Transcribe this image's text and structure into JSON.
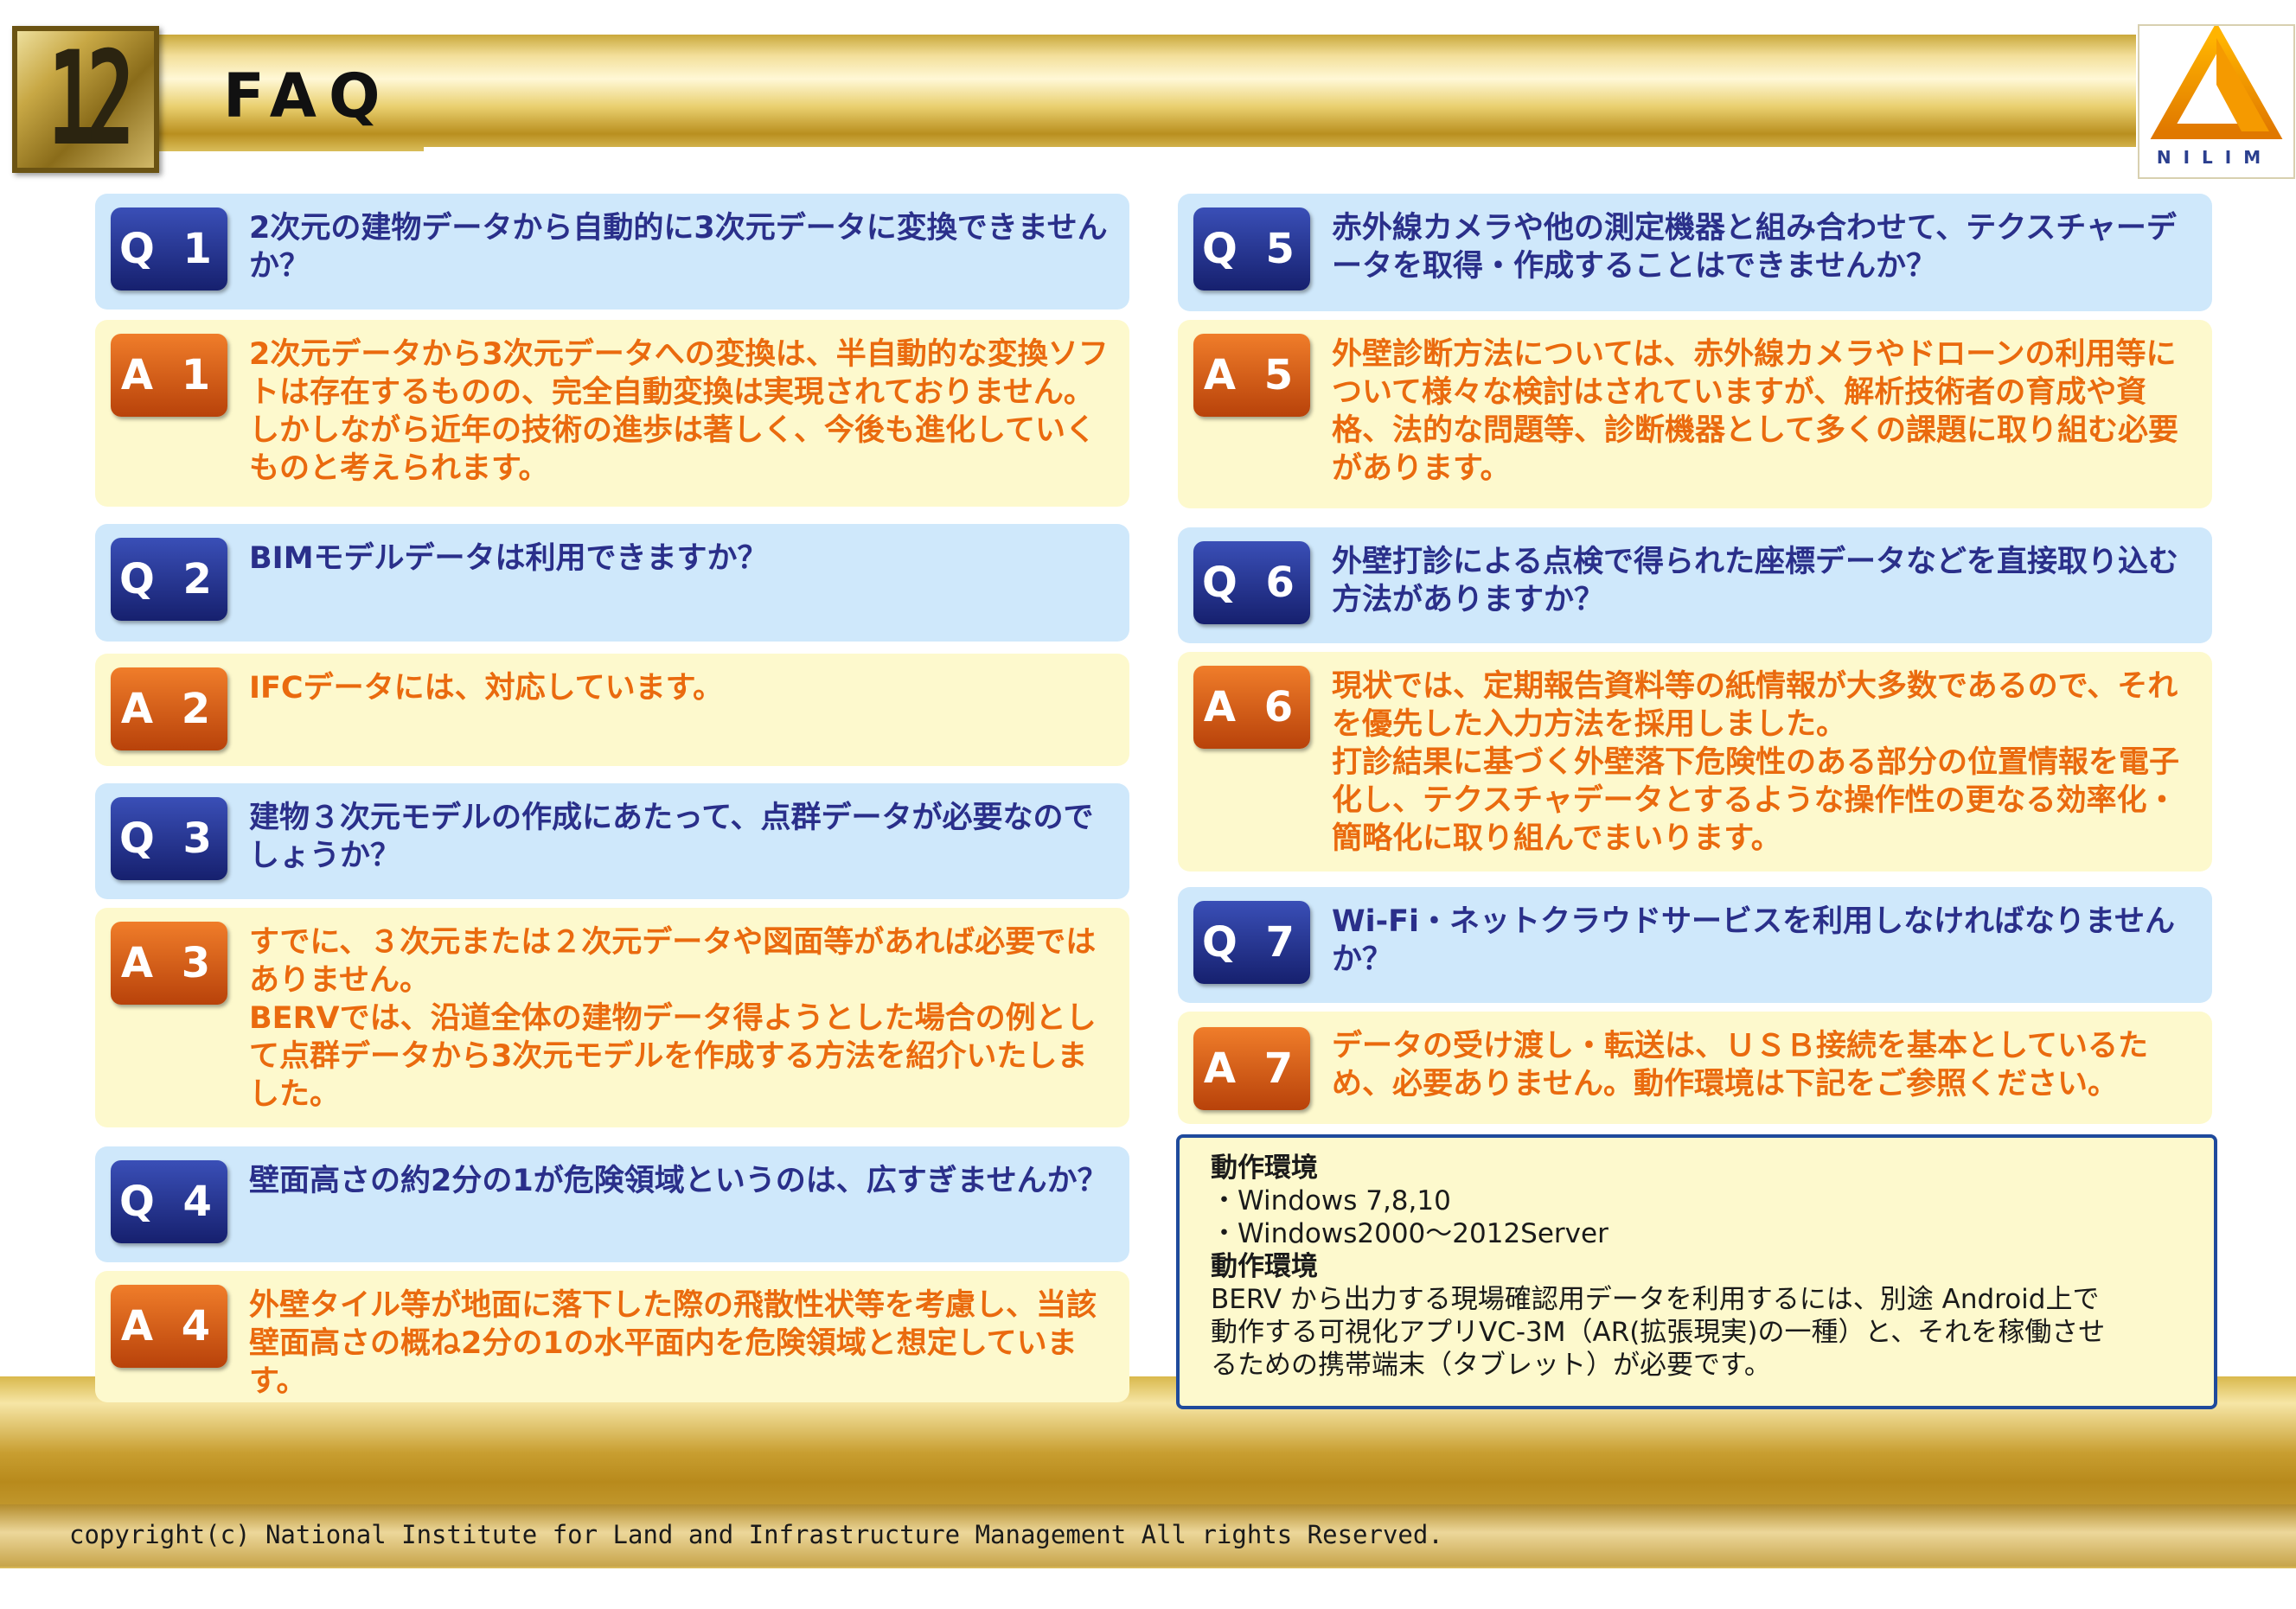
{
  "header": {
    "page_number": "12",
    "title": "FAQ",
    "logo_text": "NILIM"
  },
  "colors": {
    "question_text": "#2a2f8a",
    "answer_text": "#ea6a0e",
    "question_bg": "#cfe8fb",
    "answer_bg": "#fdf9cd",
    "gold": "#c8a03a"
  },
  "faq": [
    {
      "q_label": "Q 1",
      "q_text": "2次元の建物データから自動的に3次元データに変換できませんか？",
      "a_label": "A 1",
      "a_text": [
        "2次元データから3次元データへの変換は、半自動的な変換ソフトは存在するものの、完全自動変換は実現されておりません。しかしながら近年の技術の進歩は著しく、今後も進化していくものと考えられます。"
      ]
    },
    {
      "q_label": "Q 2",
      "q_text": "BIMモデルデータは利用できますか？",
      "a_label": "A 2",
      "a_text": [
        "IFCデータには、対応しています。"
      ]
    },
    {
      "q_label": "Q 3",
      "q_text": "建物３次元モデルの作成にあたって、点群データが必要なのでしょうか？",
      "a_label": "A 3",
      "a_text": [
        "すでに、３次元または２次元データや図面等があれば必要ではありません。",
        "BERVでは、沿道全体の建物データ得ようとした場合の例として点群データから3次元モデルを作成する方法を紹介いたしました。"
      ]
    },
    {
      "q_label": "Q 4",
      "q_text": "壁面高さの約2分の1が危険領域というのは、広すぎませんか？",
      "a_label": "A 4",
      "a_text": [
        "外壁タイル等が地面に落下した際の飛散性状等を考慮し、当該壁面高さの概ね2分の1の水平面内を危険領域と想定しています。"
      ]
    },
    {
      "q_label": "Q 5",
      "q_text": "赤外線カメラや他の測定機器と組み合わせて、テクスチャーデータを取得・作成することはできませんか？",
      "a_label": "A 5",
      "a_text": [
        "外壁診断方法については、赤外線カメラやドローンの利用等について様々な検討はされていますが、解析技術者の育成や資格、法的な問題等、診断機器として多くの課題に取り組む必要があります。"
      ]
    },
    {
      "q_label": "Q 6",
      "q_text": "外壁打診による点検で得られた座標データなどを直接取り込む方法がありますか？",
      "a_label": "A 6",
      "a_text": [
        "現状では、定期報告資料等の紙情報が大多数であるので、それを優先した入力方法を採用しました。",
        "打診結果に基づく外壁落下危険性のある部分の位置情報を電子化し、テクスチャデータとするような操作性の更なる効率化・簡略化に取り組んでまいります。"
      ]
    },
    {
      "q_label": "Q 7",
      "q_text": "Wi-Fi・ネットクラウドサービスを利用しなければなりませんか？",
      "a_label": "A 7",
      "a_text": [
        "データの受け渡し・転送は、ＵＳＢ接続を基本としているため、必要ありません。動作環境は下記をご参照ください。"
      ]
    }
  ],
  "environment": {
    "heading1": "動作環境",
    "os_items": [
      "・Windows 7,8,10",
      "・Windows2000～2012Server"
    ],
    "heading2": "動作環境",
    "note_lines": [
      "BERV から出力する現場確認用データを利用するには、別途 Android上で",
      "動作する可視化アプリVC-3M（AR(拡張現実)の一種）と、それを稼働させ",
      "るための携帯端末（タブレット）が必要です。"
    ]
  },
  "footer": {
    "copyright": "copyright(c) National Institute for Land and Infrastructure Management All rights Reserved."
  }
}
